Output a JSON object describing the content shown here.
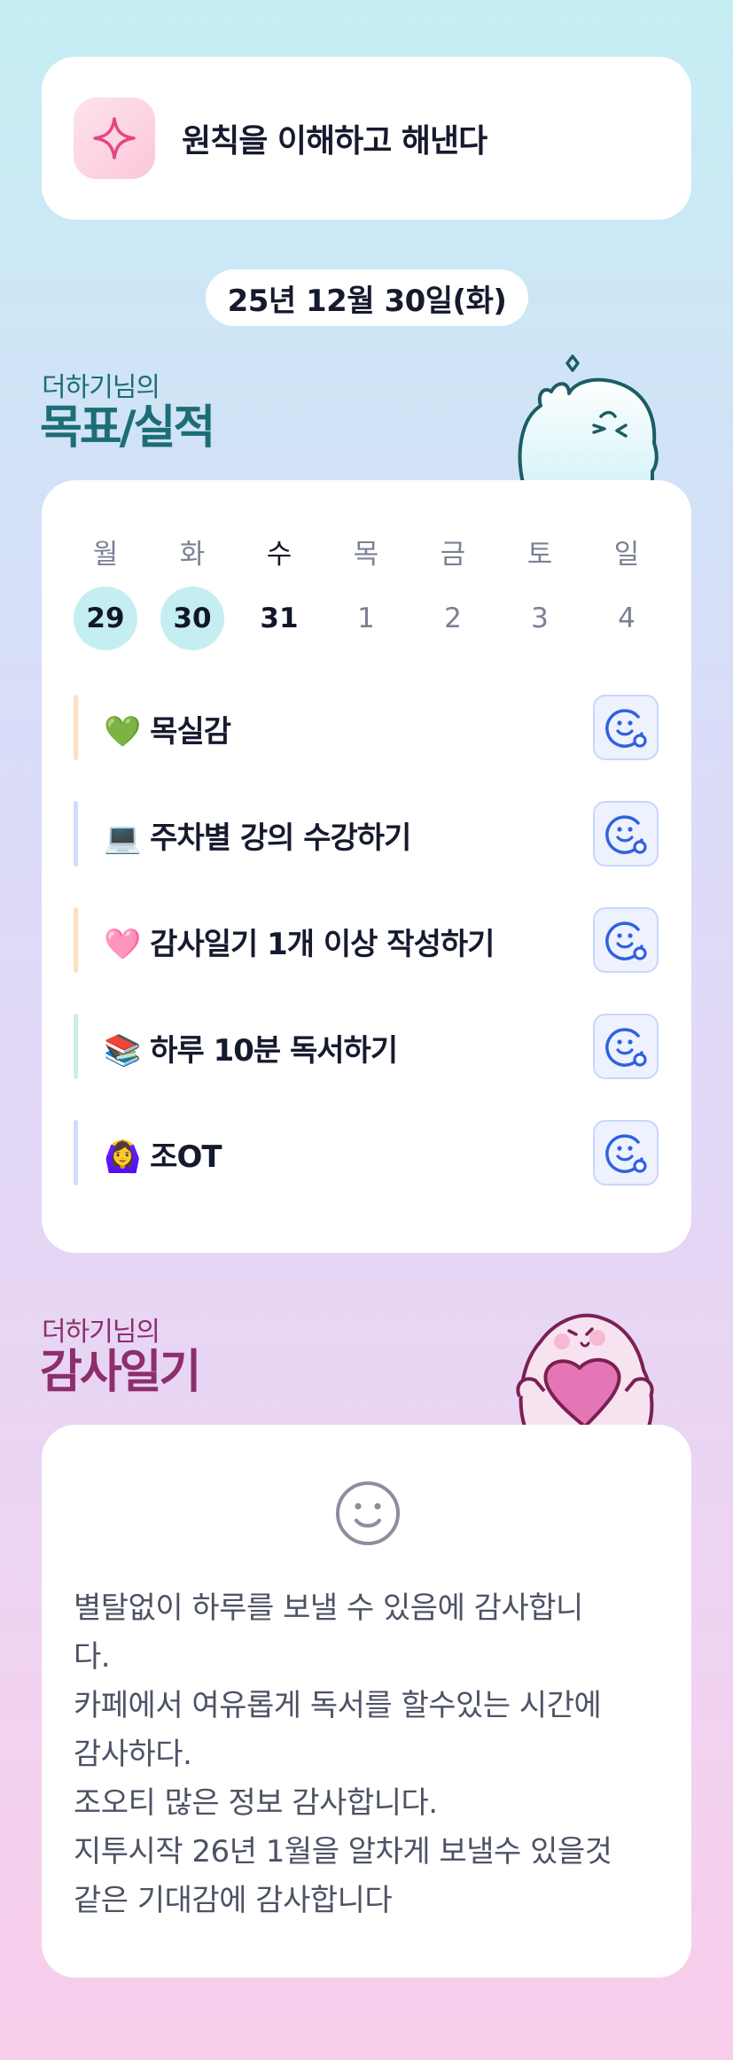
{
  "principle": {
    "icon": "sparkle-icon",
    "text": "원칙을 이해하고 해낸다"
  },
  "date_label": "25년 12월 30일(화)",
  "goals_section": {
    "subtitle": "더하기님의",
    "title": "목표/실적"
  },
  "week": {
    "days": [
      "월",
      "화",
      "수",
      "목",
      "금",
      "토",
      "일"
    ],
    "dates": [
      "29",
      "30",
      "31",
      "1",
      "2",
      "3",
      "4"
    ],
    "completed_indices": [
      0,
      1
    ],
    "today_index": 2
  },
  "goals": [
    {
      "emoji": "green-heart-emoji",
      "label": "💚 목실감",
      "bar_color": "#fde0bf"
    },
    {
      "emoji": "laptop-emoji",
      "label": "💻 주차별 강의 수강하기",
      "bar_color": "#d3dcf8"
    },
    {
      "emoji": "pink-heart-emoji",
      "label": "🩷 감사일기 1개 이상 작성하기",
      "bar_color": "#fde0bf"
    },
    {
      "emoji": "books-emoji",
      "label": "📚 하루 10분 독서하기",
      "bar_color": "#c9f1e0"
    },
    {
      "emoji": "person-gesturing-ok-emoji",
      "label": "🙆‍♀️ 조OT",
      "bar_color": "#d3dcf8"
    }
  ],
  "gratitude_section": {
    "subtitle": "더하기님의",
    "title": "감사일기"
  },
  "gratitude": {
    "icon": "smile-face-icon",
    "text": "별탈없이 하루를 보낼 수 있음에 감사합니\n다.\n카페에서 여유롭게 독서를 할수있는 시간에\n감사하다.\n조오티 많은 정보 감사합니다.\n지투시작 26년 1월을 알차게 보낼수 있을것\n같은 기대감에 감사합니다"
  },
  "colors": {
    "accent_teal": "#1d6d77",
    "accent_plum": "#8d2f6a",
    "completed_day_bg": "#c4eef2",
    "face_button_bg": "#eef2fe",
    "face_icon": "#2f62e0"
  }
}
